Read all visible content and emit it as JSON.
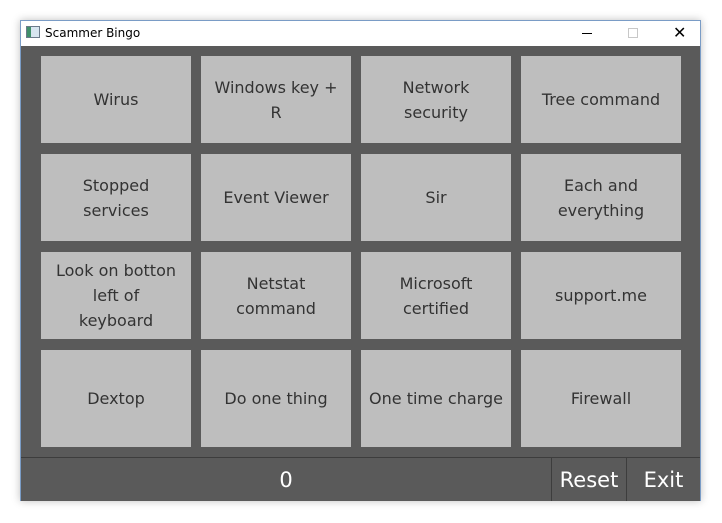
{
  "window": {
    "title": "Scammer Bingo",
    "close_glyph": "✕"
  },
  "cells": [
    [
      "Wirus",
      "Windows key + R",
      "Network security",
      "Tree command"
    ],
    [
      "Stopped services",
      "Event Viewer",
      "Sir",
      "Each and everything"
    ],
    [
      "Look on botton left of keyboard",
      "Netstat command",
      "Microsoft certified",
      "support.me"
    ],
    [
      "Dextop",
      "Do one thing",
      "One time charge",
      "Firewall"
    ]
  ],
  "footer": {
    "score": "0",
    "reset_label": "Reset",
    "exit_label": "Exit"
  }
}
